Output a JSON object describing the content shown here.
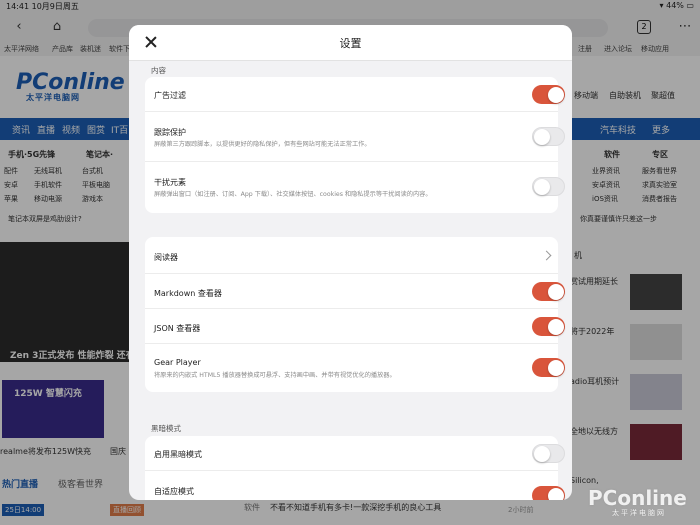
{
  "status_bar": {
    "time": "14:41",
    "date": "10月9日周五",
    "battery": "44%"
  },
  "browser": {
    "tab_count": "2"
  },
  "bookmarks": [
    "太平洋网络",
    "产品库",
    "装机迷",
    "软件下",
    "注册",
    "进入论坛",
    "移动应用"
  ],
  "site": {
    "logo": "PConline",
    "logo_sub": "太平洋电脑网",
    "nav": [
      "资讯",
      "直播",
      "视频",
      "图赏",
      "IT百",
      "汽车科技",
      "更多"
    ],
    "quick_links": [
      "移动端",
      "自助装机",
      "聚超值"
    ],
    "categories": [
      "手机·5G先锋",
      "笔记本·",
      "软件",
      "专区"
    ],
    "sub_links_left": [
      "配件",
      "无线耳机",
      "台式机",
      "安卓",
      "手机软件",
      "平板电脑",
      "苹果",
      "移动电源",
      "游戏本"
    ],
    "sub_links_right": [
      "业界资讯",
      "安卓资讯",
      "iOS资讯",
      "服务看世界",
      "求真实验室",
      "消费者报告"
    ],
    "news_left": "笔记本双屏是鸡肋设计?",
    "news_right": "你真要谨慎许只差这一步",
    "promo_caption": "Zen 3正式发布 性能炸裂 还有",
    "promo2_title": "125W 智慧闪充",
    "promo2_caption": "realme将发布125W快充",
    "promo2_caption2": "国庆",
    "right_news": [
      "机",
      "赏试用期延长",
      "将于2022年",
      "adio耳机预计",
      "全地以无线方",
      "Silicon,"
    ],
    "bottom_tabs": [
      "热门直播",
      "极客看世界"
    ],
    "bottom_news_tag": "软件",
    "bottom_news": "不看不知道手机有多卡!一款深挖手机的良心工具",
    "bottom_time": "2小时前",
    "live_time": "25日14:00",
    "live_tag": "直播回顾",
    "watermark": "PConline",
    "watermark_sub": "太平洋电脑网"
  },
  "modal": {
    "title": "设置",
    "sections": {
      "content": {
        "label": "内容",
        "rows": [
          {
            "title": "广告过滤",
            "desc": "",
            "on": true
          },
          {
            "title": "跟踪保护",
            "desc": "屏蔽第三方跟踪脚本，以提供更好的隐私保护，但有些网站可能无法正常工作。",
            "on": false
          },
          {
            "title": "干扰元素",
            "desc": "屏蔽弹出窗口（如注册、订阅、App 下载）、社交媒体按钮、cookies 和隐私提示等干扰阅读的内容。",
            "on": false
          }
        ]
      },
      "viewers": {
        "rows": [
          {
            "title": "阅读器",
            "desc": "",
            "type": "link"
          },
          {
            "title": "Markdown 查看器",
            "desc": "",
            "on": true
          },
          {
            "title": "JSON 查看器",
            "desc": "",
            "on": true
          },
          {
            "title": "Gear Player",
            "desc": "将原来的内嵌式 HTML5 播放器替换成可悬浮、支持画中画、并带有视觉优化的播放器。",
            "on": true
          }
        ]
      },
      "dark": {
        "label": "黑暗模式",
        "rows": [
          {
            "title": "启用黑暗模式",
            "desc": "",
            "on": false
          },
          {
            "title": "自适应模式",
            "desc": "",
            "on": true
          }
        ]
      }
    }
  },
  "colors": {
    "accent": "#d9553b",
    "brand": "#1c5fb6",
    "toggle_off": "#e9e9eb"
  }
}
